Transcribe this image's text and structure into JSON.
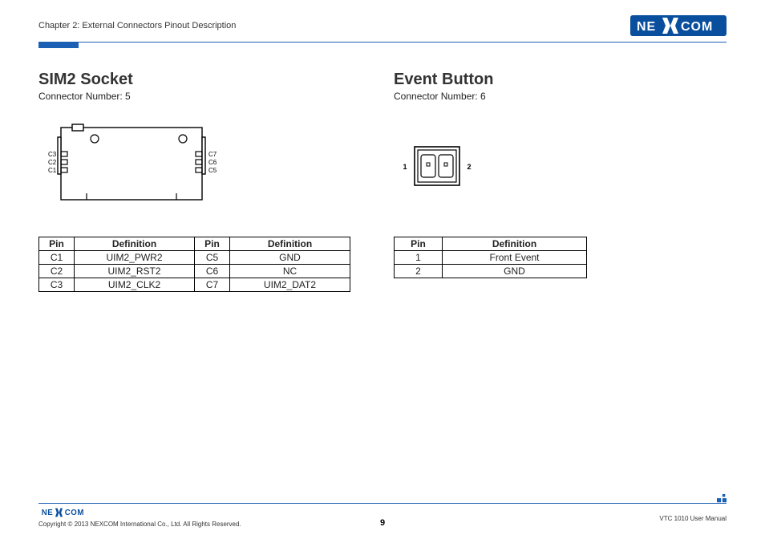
{
  "header": {
    "chapter": "Chapter 2: External Connectors Pinout Description"
  },
  "brand": {
    "name": "NEXCOM"
  },
  "left": {
    "title": "SIM2 Socket",
    "subtitle": "Connector Number: 5",
    "diagram_labels": {
      "c1": "C1",
      "c2": "C2",
      "c3": "C3",
      "c5": "C5",
      "c6": "C6",
      "c7": "C7"
    },
    "table": {
      "headers": {
        "pin": "Pin",
        "def": "Definition"
      },
      "rows": [
        {
          "pinA": "C1",
          "defA": "UIM2_PWR2",
          "pinB": "C5",
          "defB": "GND"
        },
        {
          "pinA": "C2",
          "defA": "UIM2_RST2",
          "pinB": "C6",
          "defB": "NC"
        },
        {
          "pinA": "C3",
          "defA": "UIM2_CLK2",
          "pinB": "C7",
          "defB": "UIM2_DAT2"
        }
      ]
    }
  },
  "right": {
    "title": "Event Button",
    "subtitle": "Connector Number: 6",
    "diagram_labels": {
      "p1": "1",
      "p2": "2"
    },
    "table": {
      "headers": {
        "pin": "Pin",
        "def": "Definition"
      },
      "rows": [
        {
          "pin": "1",
          "def": "Front Event"
        },
        {
          "pin": "2",
          "def": "GND"
        }
      ]
    }
  },
  "footer": {
    "copyright": "Copyright © 2013 NEXCOM International Co., Ltd. All Rights Reserved.",
    "page": "9",
    "manual": "VTC 1010 User Manual"
  }
}
